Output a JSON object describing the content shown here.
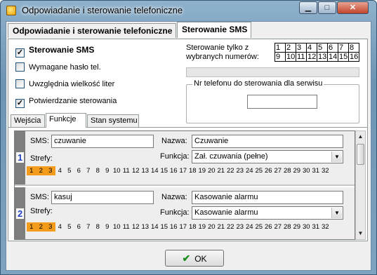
{
  "window": {
    "title": "Odpowiadanie i sterowanie telefoniczne"
  },
  "tabs": [
    "Odpowiadanie i sterowanie telefoniczne",
    "Sterowanie SMS"
  ],
  "sms": {
    "enable_label": "Sterowanie SMS",
    "enable_checked": true,
    "options": [
      {
        "label": "Wymagane hasło tel.",
        "checked": false
      },
      {
        "label": "Uwzględnia wielkość liter",
        "checked": false
      },
      {
        "label": "Potwierdzanie sterowania",
        "checked": true
      }
    ],
    "numbers_label": "Sterowanie tylko z wybranych numerów:",
    "numbers": [
      "1",
      "2",
      "3",
      "4",
      "5",
      "6",
      "7",
      "8",
      "9",
      "10",
      "11",
      "12",
      "13",
      "14",
      "15",
      "16"
    ],
    "service_label": "Nr telefonu do sterowania dla serwisu",
    "service_value": ""
  },
  "subtabs": [
    "Wejścia",
    "Funkcje",
    "Stan systemu"
  ],
  "entries": [
    {
      "index": "1",
      "sms_label": "SMS:",
      "sms_value": "czuwanie",
      "name_label": "Nazwa:",
      "name_value": "Czuwanie",
      "zones_label": "Strefy:",
      "function_label": "Funkcja:",
      "function_value": "Zał. czuwania (pełne)",
      "zones_on": [
        1,
        2,
        3
      ]
    },
    {
      "index": "2",
      "sms_label": "SMS:",
      "sms_value": "kasuj",
      "name_label": "Nazwa:",
      "name_value": "Kasowanie alarmu",
      "zones_label": "Strefy:",
      "function_label": "Funkcja:",
      "function_value": "Kasowanie alarmu",
      "zones_on": [
        1,
        2,
        3
      ]
    }
  ],
  "zones": [
    "1",
    "2",
    "3",
    "4",
    "5",
    "6",
    "7",
    "8",
    "9",
    "10",
    "11",
    "12",
    "13",
    "14",
    "15",
    "16",
    "17",
    "18",
    "19",
    "20",
    "21",
    "22",
    "23",
    "24",
    "25",
    "26",
    "27",
    "28",
    "29",
    "30",
    "31",
    "32"
  ],
  "ok_label": "OK",
  "colors": {
    "zone_active": "#f39c1c",
    "index_text": "#1f3fbd"
  }
}
